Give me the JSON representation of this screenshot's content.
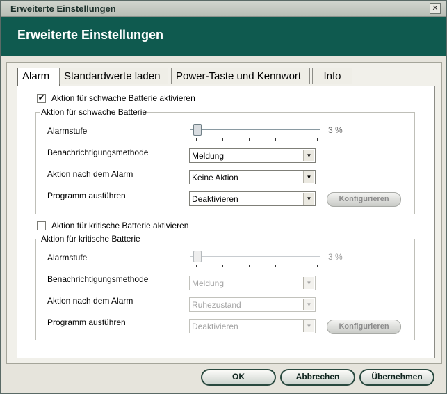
{
  "window": {
    "title": "Erweiterte Einstellungen",
    "close_glyph": "✕"
  },
  "banner": {
    "heading": "Erweiterte Einstellungen"
  },
  "tabs": [
    {
      "label": "Alarm",
      "active": true
    },
    {
      "label": "Standardwerte laden",
      "active": false
    },
    {
      "label": "Power-Taste und Kennwort",
      "active": false
    },
    {
      "label": "Info",
      "active": false
    }
  ],
  "low": {
    "checkbox_label": "Aktion für schwache Batterie aktivieren",
    "checked": true,
    "group_title": "Aktion für schwache Batterie",
    "alarm_label": "Alarmstufe",
    "alarm_value": "3 %",
    "alarm_level": 0.03,
    "notify_label": "Benachrichtigungsmethode",
    "notify_value": "Meldung",
    "action_label": "Aktion nach dem Alarm",
    "action_value": "Keine Aktion",
    "program_label": "Programm ausführen",
    "program_value": "Deaktivieren",
    "config_button": "Konfigurieren"
  },
  "critical": {
    "checkbox_label": "Aktion für kritische Batterie aktivieren",
    "checked": false,
    "group_title": "Aktion für kritische Batterie",
    "alarm_label": "Alarmstufe",
    "alarm_value": "3 %",
    "alarm_level": 0.03,
    "notify_label": "Benachrichtigungsmethode",
    "notify_value": "Meldung",
    "action_label": "Aktion nach dem Alarm",
    "action_value": "Ruhezustand",
    "program_label": "Programm ausführen",
    "program_value": "Deaktivieren",
    "config_button": "Konfigurieren"
  },
  "buttons": {
    "ok": "OK",
    "cancel": "Abbrechen",
    "apply": "Übernehmen"
  },
  "colors": {
    "banner": "#0f5a4f",
    "button_border": "#29493f"
  }
}
